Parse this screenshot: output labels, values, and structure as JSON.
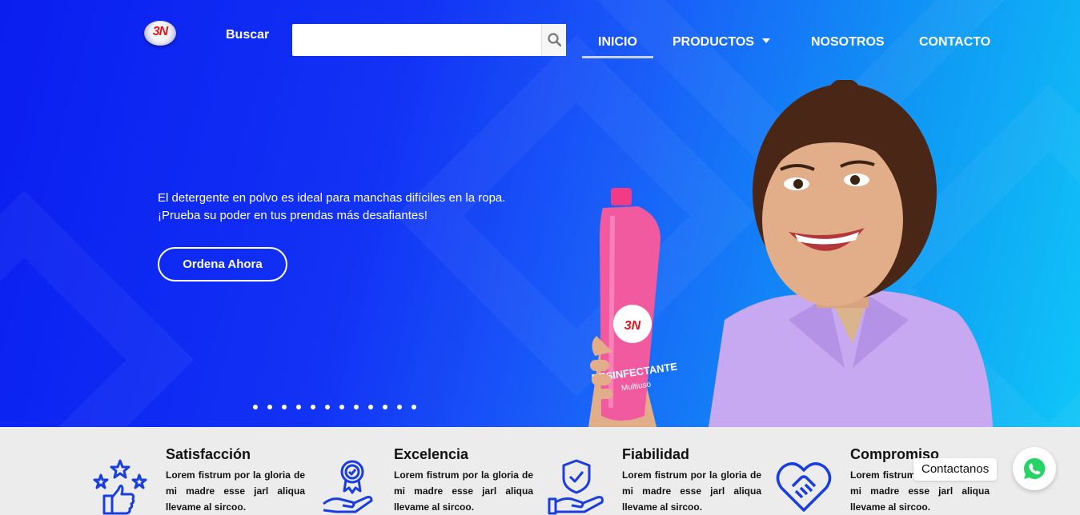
{
  "brand": {
    "logo_text": "3N"
  },
  "search": {
    "label": "Buscar",
    "placeholder": ""
  },
  "nav": {
    "items": [
      {
        "label": "INICIO",
        "active": true
      },
      {
        "label": "PRODUCTOS",
        "has_dropdown": true
      },
      {
        "label": "NOSOTROS"
      },
      {
        "label": "CONTACTO"
      }
    ]
  },
  "hero": {
    "text": "El detergente en polvo es ideal para manchas difíciles en la ropa. ¡Prueba su poder en tus prendas más desafiantes!",
    "cta_label": "Ordena Ahora",
    "product_label": "DESINFECTANTE",
    "product_sublabel": "Multiuso",
    "slide_count": 12,
    "active_slide": 1
  },
  "features": [
    {
      "title": "Satisfacción",
      "body": "Lorem fistrum por la gloria de mi madre esse jarl aliqua llevame al sircoo.",
      "icon": "thumbs-up-stars-icon"
    },
    {
      "title": "Excelencia",
      "body": "Lorem fistrum por la gloria de mi madre esse jarl aliqua llevame al sircoo.",
      "icon": "award-hand-icon"
    },
    {
      "title": "Fiabilidad",
      "body": "Lorem fistrum por la gloria de mi madre esse jarl aliqua llevame al sircoo.",
      "icon": "shield-hand-icon"
    },
    {
      "title": "Compromiso",
      "body": "Lorem fistrum por la gloria de mi madre esse jarl aliqua llevame al sircoo.",
      "icon": "heart-handshake-icon"
    }
  ],
  "whatsapp": {
    "label": "Contactanos"
  },
  "colors": {
    "primary_blue": "#1232f5",
    "accent_cyan": "#0fc6f7",
    "icon_blue": "#1a3de0",
    "whatsapp_green": "#25d366"
  }
}
